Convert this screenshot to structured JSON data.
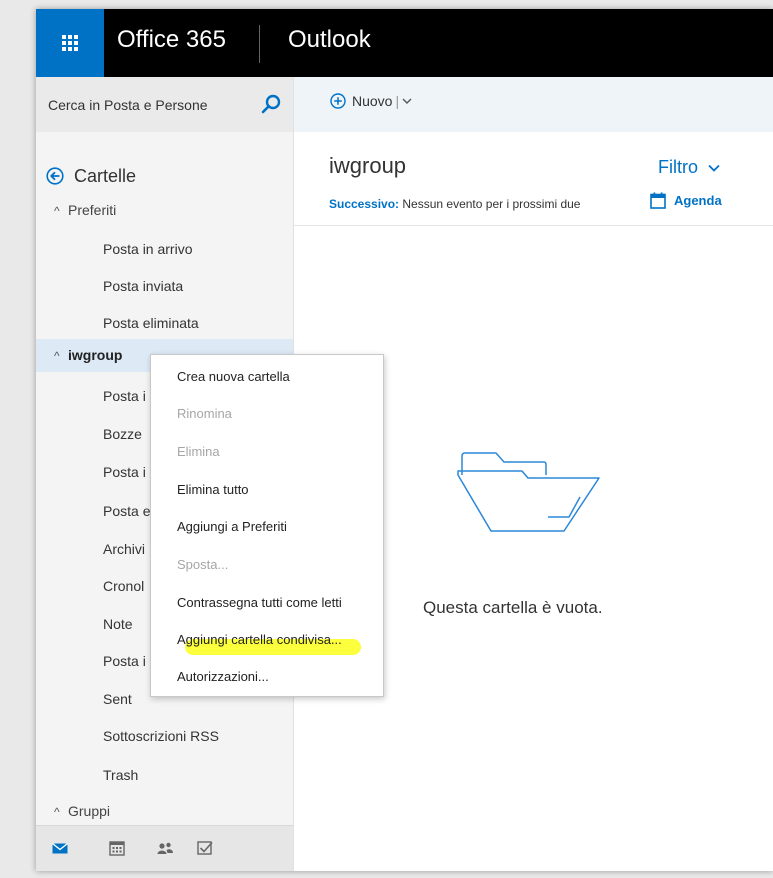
{
  "header": {
    "brand": "Office 365",
    "app": "Outlook"
  },
  "search": {
    "placeholder": "Cerca in Posta e Persone"
  },
  "toolbar": {
    "new_label": "Nuovo",
    "separator": "|"
  },
  "sidebar": {
    "folders_title": "Cartelle",
    "favorites": {
      "label": "Preferiti",
      "items": [
        "Posta in arrivo",
        "Posta inviata",
        "Posta eliminata"
      ]
    },
    "account": {
      "label": "iwgroup",
      "items": [
        "Posta i",
        "Bozze",
        "Posta i",
        "Posta e",
        "Archivi",
        "Cronol",
        "Note",
        "Posta i",
        "Sent",
        "Sottoscrizioni RSS",
        "Trash"
      ]
    },
    "groups": {
      "label": "Gruppi"
    }
  },
  "main": {
    "folder_title": "iwgroup",
    "filter_label": "Filtro",
    "next_label": "Successivo:",
    "next_text": "Nessun evento per i prossimi due",
    "agenda_label": "Agenda",
    "empty_message": "Questa cartella è vuota."
  },
  "context_menu": {
    "items": [
      {
        "label": "Crea nuova cartella",
        "enabled": true
      },
      {
        "label": "Rinomina",
        "enabled": false
      },
      {
        "label": "Elimina",
        "enabled": false
      },
      {
        "label": "Elimina tutto",
        "enabled": true
      },
      {
        "label": "Aggiungi a Preferiti",
        "enabled": true
      },
      {
        "label": "Sposta...",
        "enabled": false
      },
      {
        "label": "Contrassegna tutti come letti",
        "enabled": true
      },
      {
        "label": "Aggiungi cartella condivisa...",
        "enabled": true,
        "highlighted": true
      },
      {
        "label": "Autorizzazioni...",
        "enabled": true
      }
    ]
  },
  "bottom_nav": [
    "mail-icon",
    "calendar-icon",
    "people-icon",
    "tasks-icon"
  ],
  "colors": {
    "accent": "#0072c6",
    "topbar": "#000000",
    "highlight": "#fbff3c",
    "disabled_text": "#a6a6a6"
  }
}
